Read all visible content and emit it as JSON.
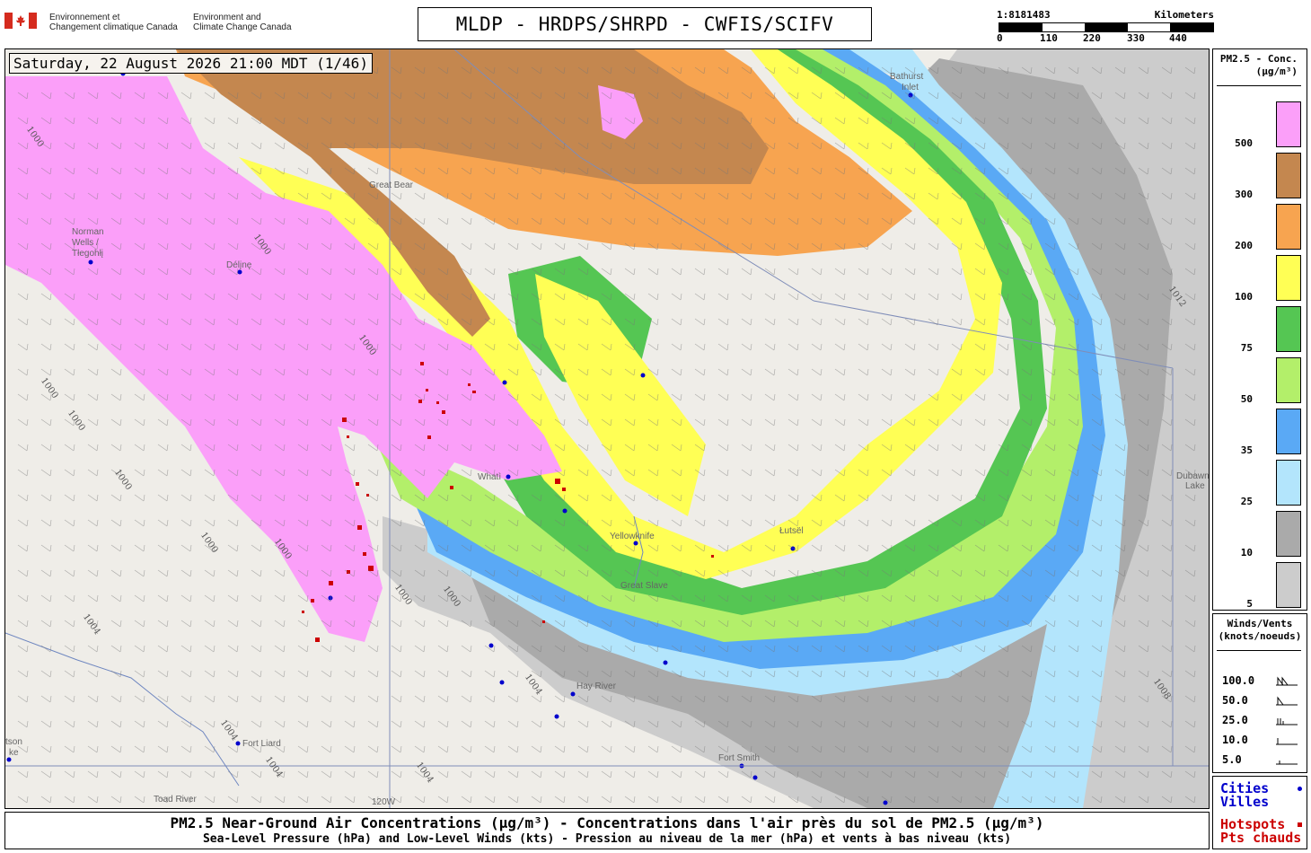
{
  "header": {
    "gov_fr_line1": "Environnement et",
    "gov_fr_line2": "Changement climatique Canada",
    "gov_en_line1": "Environment and",
    "gov_en_line2": "Climate Change Canada",
    "title": "MLDP - HRDPS/SHRPD - CWFIS/SCIFV",
    "flag_color": "#d52b1e"
  },
  "scale": {
    "ratio": "1:8181483",
    "unit": "Kilometers",
    "ticks": [
      "0",
      "110",
      "220",
      "330",
      "440"
    ]
  },
  "map": {
    "timestamp": "Saturday, 22 August 2026 21:00 MDT (1/46)",
    "places": [
      {
        "name": "Norman"
      },
      {
        "name": "Wells /"
      },
      {
        "name": "Tłegohłį"
      },
      {
        "name": "Délįnę"
      },
      {
        "name": "Great Bear"
      },
      {
        "name": "Bathurst"
      },
      {
        "name": "Inlet"
      },
      {
        "name": "Whatì"
      },
      {
        "name": "Yellowknife"
      },
      {
        "name": "Łutsël"
      },
      {
        "name": "Great Slave"
      },
      {
        "name": "Hay River"
      },
      {
        "name": "Fort Liard"
      },
      {
        "name": "Fort Smith"
      },
      {
        "name": "Toad River"
      },
      {
        "name": "Dubawnt"
      },
      {
        "name": "Lake"
      },
      {
        "name": "tson"
      },
      {
        "name": "ke"
      },
      {
        "name": "120W"
      }
    ],
    "isobars": [
      "1000",
      "1000",
      "1000",
      "1000",
      "1000",
      "1000",
      "1000",
      "1000",
      "1000",
      "1000",
      "1004",
      "1004",
      "1004",
      "1004",
      "1004",
      "1008",
      "1012"
    ],
    "palette": {
      "c5": "#cccccc",
      "c10": "#aaaaaa",
      "c25": "#b3e5fc",
      "c35": "#5aa9f5",
      "c50": "#b3ef6a",
      "c75": "#55c653",
      "c100": "#ffff55",
      "c200": "#f7a450",
      "c300": "#c4874f",
      "c500": "#fb9ff9",
      "hotspot": "#cc0000",
      "city": "#0000cc"
    }
  },
  "legend": {
    "title_line1": "PM2.5 - Conc.",
    "title_line2": "(μg/m³)",
    "items": [
      {
        "label": "500",
        "color": "#fb9ff9"
      },
      {
        "label": "300",
        "color": "#c4874f"
      },
      {
        "label": "200",
        "color": "#f7a450"
      },
      {
        "label": "100",
        "color": "#ffff55"
      },
      {
        "label": "75",
        "color": "#55c653"
      },
      {
        "label": "50",
        "color": "#b3ef6a"
      },
      {
        "label": "35",
        "color": "#5aa9f5"
      },
      {
        "label": "25",
        "color": "#b3e5fc"
      },
      {
        "label": "10",
        "color": "#aaaaaa"
      },
      {
        "label": "5",
        "color": "#cccccc"
      }
    ]
  },
  "winds": {
    "title_line1": "Winds/Vents",
    "title_line2": "(knots/noeuds)",
    "items": [
      "100.0",
      "50.0",
      "25.0",
      "10.0",
      "5.0"
    ]
  },
  "keys": {
    "cities_en": "Cities",
    "cities_fr": "Villes",
    "hotspots_en": "Hotspots",
    "hotspots_fr": "Pts chauds",
    "city_color": "#0000cc",
    "hotspot_color": "#cc0000"
  },
  "footer": {
    "line1": "PM2.5 Near-Ground Air Concentrations (μg/m³) - Concentrations dans l'air près du sol de PM2.5 (μg/m³)",
    "line2": "Sea-Level Pressure (hPa) and Low-Level Winds (kts) - Pression au niveau de la mer (hPa) et vents à bas niveau (kts)"
  }
}
